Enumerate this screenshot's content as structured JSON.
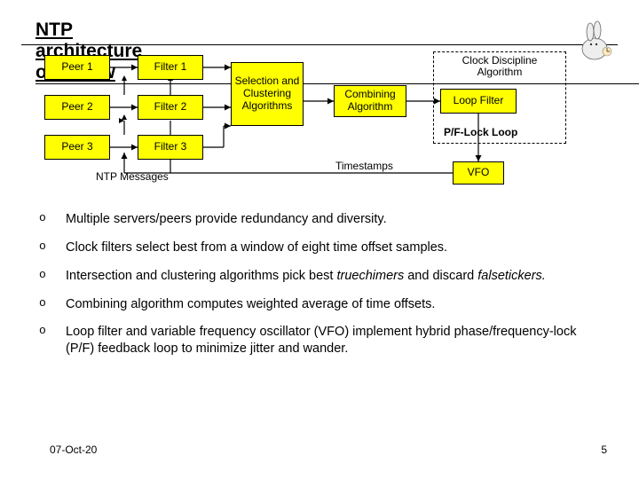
{
  "title": "NTP architecture overview",
  "diagram": {
    "peer1": "Peer 1",
    "peer2": "Peer 2",
    "peer3": "Peer 3",
    "filter1": "Filter 1",
    "filter2": "Filter 2",
    "filter3": "Filter 3",
    "selection": "Selection and Clustering Algorithms",
    "combining": "Combining Algorithm",
    "loop_filter": "Loop Filter",
    "vfo": "VFO",
    "cda": "Clock Discipline Algorithm",
    "pf_lock": "P/F-Lock Loop",
    "ntp_messages": "NTP Messages",
    "timestamps": "Timestamps"
  },
  "bullets": {
    "b1": "Multiple servers/peers provide redundancy and diversity.",
    "b2": "Clock filters select best from a window of eight time offset samples.",
    "b3_a": "Intersection and clustering algorithms pick best ",
    "b3_tc": "truechimers",
    "b3_b": " and discard ",
    "b3_ft": "falsetickers.",
    "b4": "Combining algorithm computes weighted average of time offsets.",
    "b5": "Loop filter and variable frequency oscillator (VFO) implement hybrid phase/frequency-lock (P/F) feedback loop to minimize jitter and wander."
  },
  "footer": {
    "date": "07-Oct-20",
    "page": "5"
  }
}
